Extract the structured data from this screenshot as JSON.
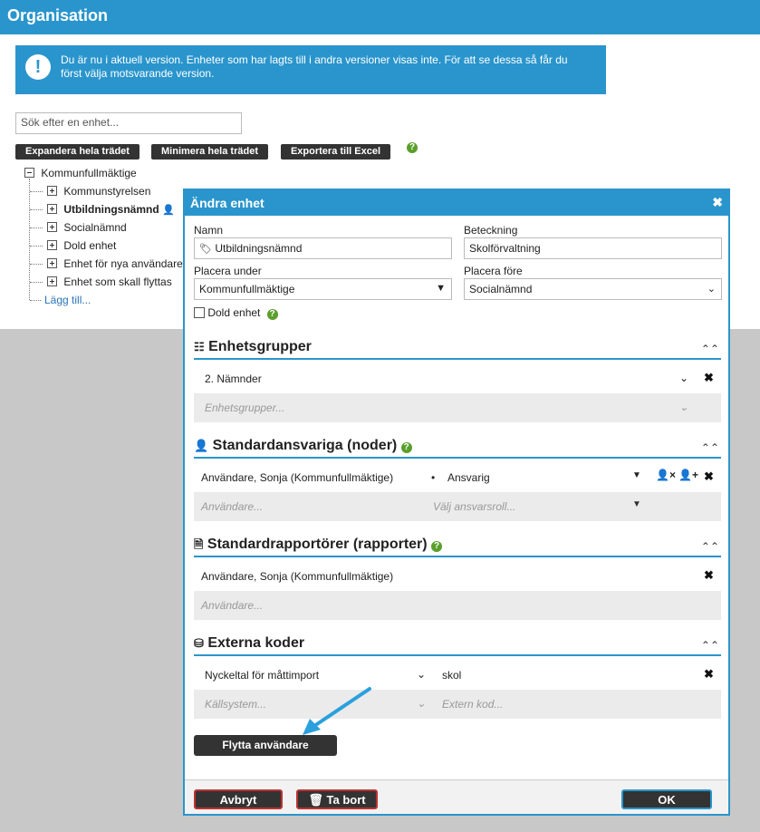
{
  "header": {
    "title": "Organisation"
  },
  "info": {
    "text": "Du är nu i aktuell version. Enheter som har lagts till i andra versioner visas inte. För att se dessa så får du först välja motsvarande version."
  },
  "search": {
    "placeholder": "Sök efter en enhet..."
  },
  "toolbar": {
    "expand_label": "Expandera hela trädet",
    "collapse_label": "Minimera hela trädet",
    "export_label": "Exportera till Excel"
  },
  "tree": {
    "root": "Kommunfullmäktige",
    "items": [
      "Kommunstyrelsen",
      "Utbildningsnämnd",
      "Socialnämnd",
      "Dold enhet",
      "Enhet för nya användare",
      "Enhet som skall flyttas"
    ],
    "add_label": "Lägg till..."
  },
  "modal": {
    "title": "Ändra enhet",
    "name_label": "Namn",
    "name_value": "Utbildningsnämnd",
    "designation_label": "Beteckning",
    "designation_value": "Skolförvaltning",
    "place_under_label": "Placera under",
    "place_under_value": "Kommunfullmäktige",
    "place_before_label": "Placera före",
    "place_before_value": "Socialnämnd",
    "hidden_label": "Dold enhet",
    "groups": {
      "title": "Enhetsgrupper",
      "row_value": "2. Nämnder",
      "placeholder": "Enhetsgrupper..."
    },
    "responsible": {
      "title": "Standardansvariga (noder)",
      "user": "Användare, Sonja (Kommunfullmäktige)",
      "role": "Ansvarig",
      "user_placeholder": "Användare...",
      "role_placeholder": "Välj ansvarsroll..."
    },
    "reporters": {
      "title": "Standardrapportörer (rapporter)",
      "user": "Användare, Sonja (Kommunfullmäktige)",
      "placeholder": "Användare..."
    },
    "codes": {
      "title": "Externa koder",
      "system": "Nyckeltal för måttimport",
      "code": "skol",
      "system_placeholder": "Källsystem...",
      "code_placeholder": "Extern kod..."
    },
    "move_users_label": "Flytta användare",
    "cancel_label": "Avbryt",
    "delete_label": "Ta bort",
    "ok_label": "OK"
  }
}
